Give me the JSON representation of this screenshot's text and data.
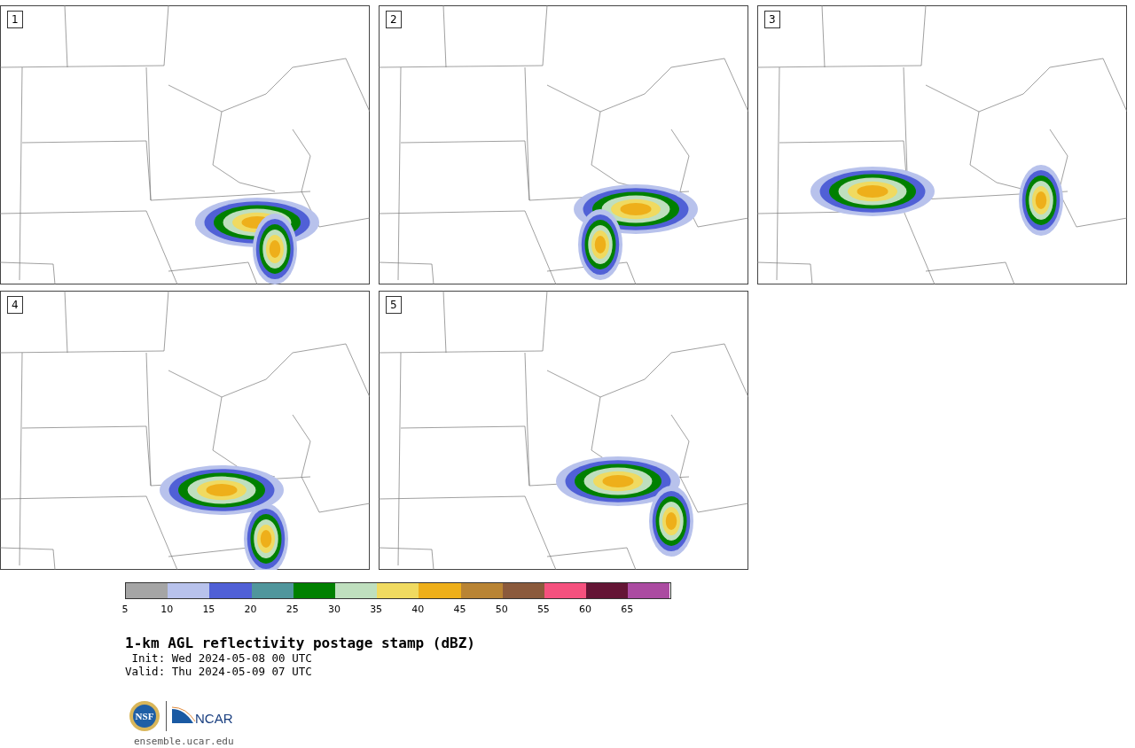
{
  "panels": [
    {
      "label": "1"
    },
    {
      "label": "2"
    },
    {
      "label": "3"
    },
    {
      "label": "4"
    },
    {
      "label": "5"
    }
  ],
  "colorbar": {
    "bins": [
      {
        "color": "#a5a5a5"
      },
      {
        "color": "#b8c2ec"
      },
      {
        "color": "#5060d6"
      },
      {
        "color": "#50969c"
      },
      {
        "color": "#008000"
      },
      {
        "color": "#bfdfbe"
      },
      {
        "color": "#f0da60"
      },
      {
        "color": "#eeaf1a"
      },
      {
        "color": "#b98434"
      },
      {
        "color": "#8b5a3c"
      },
      {
        "color": "#f5517e"
      },
      {
        "color": "#641535"
      },
      {
        "color": "#ab4ba1"
      }
    ],
    "ticks": [
      "5",
      "10",
      "15",
      "20",
      "25",
      "30",
      "35",
      "40",
      "45",
      "50",
      "55",
      "60",
      "65"
    ]
  },
  "title": "1-km AGL reflectivity postage stamp (dBZ)",
  "init": " Init: Wed 2024-05-08 00 UTC",
  "valid": "Valid: Thu 2024-05-09 07 UTC",
  "logos": {
    "nsf": "NSF",
    "ncar": "NCAR"
  },
  "url": "ensemble.ucar.edu"
}
